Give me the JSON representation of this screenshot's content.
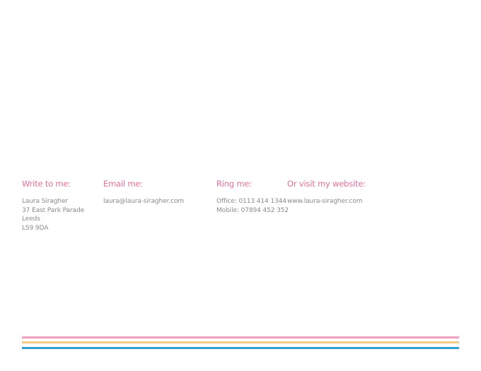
{
  "contact": {
    "write": {
      "heading": "Write to me:",
      "lines": [
        "Laura Siragher",
        "37 East Park Parade",
        "Leeds",
        "LS9 9DA"
      ]
    },
    "email": {
      "heading": "Email me:",
      "lines": [
        "laura@laura-siragher.com"
      ]
    },
    "ring": {
      "heading": "Ring me:",
      "lines": [
        "Office: 0113 414 1344",
        "Mobile: 07894 452 352"
      ]
    },
    "website": {
      "heading": "Or visit my website:",
      "lines": [
        "www.laura-siragher.com"
      ]
    }
  },
  "colors": {
    "heading": "#e0709a",
    "body_text": "#8a8a8a",
    "stripe_pink": "#f0a0be",
    "stripe_yellow": "#f5c98a",
    "stripe_blue": "#2f9fd6"
  }
}
